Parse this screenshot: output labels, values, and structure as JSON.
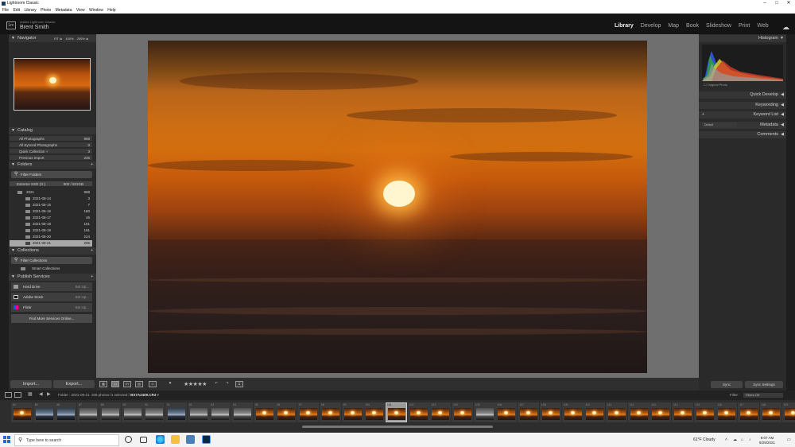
{
  "window": {
    "title": "Lightroom Classic",
    "minimize": "–",
    "maximize": "□",
    "close": "✕"
  },
  "menu": [
    "File",
    "Edit",
    "Library",
    "Photo",
    "Metadata",
    "View",
    "Window",
    "Help"
  ],
  "identity": {
    "app": "Adobe Lightroom Classic",
    "user": "Brent Smith",
    "logo": "Lrc"
  },
  "modules": [
    "Library",
    "Develop",
    "Map",
    "Book",
    "Slideshow",
    "Print",
    "Web"
  ],
  "active_module": "Library",
  "navigator": {
    "label": "Navigator",
    "zoom": [
      "FIT ≑",
      "100%",
      "200% ≑"
    ]
  },
  "catalog": {
    "label": "Catalog",
    "items": [
      {
        "name": "All Photographs",
        "count": "968"
      },
      {
        "name": "All Synced Photographs",
        "count": "0"
      },
      {
        "name": "Quick Collection +",
        "count": "3"
      },
      {
        "name": "Previous Import",
        "count": "245"
      }
    ]
  },
  "folders": {
    "label": "Folders",
    "filter": "Filter Folders",
    "drive": {
      "name": "Extreme SSD (G:)",
      "space": "900 / 931GB"
    },
    "year": {
      "name": "2021",
      "count": "968"
    },
    "items": [
      {
        "name": "2021-08-14",
        "count": "3"
      },
      {
        "name": "2021-08-15",
        "count": "7"
      },
      {
        "name": "2021-08-16",
        "count": "180"
      },
      {
        "name": "2021-08-17",
        "count": "46"
      },
      {
        "name": "2021-08-18",
        "count": "161"
      },
      {
        "name": "2021-08-19",
        "count": "191"
      },
      {
        "name": "2021-08-20",
        "count": "224"
      },
      {
        "name": "2021-08-21",
        "count": "206"
      }
    ]
  },
  "collections": {
    "label": "Collections",
    "filter": "Filter Collections",
    "items": [
      "Smart Collections"
    ]
  },
  "publish": {
    "label": "Publish Services",
    "items": [
      {
        "name": "Hard Drive",
        "setup": "Set Up..."
      },
      {
        "name": "Adobe Stock",
        "setup": "Set Up..."
      },
      {
        "name": "Flickr",
        "setup": "Set Up..."
      }
    ],
    "more": "Find More Services Online..."
  },
  "buttons": {
    "import": "Import...",
    "export": "Export...",
    "sync": "Sync",
    "sync_settings": "Sync Settings"
  },
  "right": {
    "histogram": "Histogram",
    "exif": [
      "ISO 100",
      "84 mm",
      "f / 11.0",
      "1/2000 sec"
    ],
    "original": "Original Photo",
    "panels": [
      "Quick Develop",
      "Keywording",
      "Keyword List",
      "Metadata",
      "Comments"
    ],
    "saved_preset": "Custom",
    "metadata_preset": "Default"
  },
  "toolbar": {
    "stars": "★★★★★"
  },
  "filmstrip": {
    "source": "Folder : 2021-08-21",
    "count": "206 photos /1 selected /",
    "file": "BS7A2409.CR3",
    "filter_label": "Filter :",
    "filter_value": "Filters Off",
    "numbers": [
      "84",
      "85",
      "86",
      "87",
      "88",
      "89",
      "90",
      "91",
      "92",
      "93",
      "94",
      "95",
      "96",
      "97",
      "98",
      "99",
      "100",
      "101",
      "102",
      "103",
      "104",
      "105",
      "106",
      "107",
      "108",
      "109",
      "110",
      "111",
      "112",
      "113",
      "114",
      "115",
      "116",
      "117",
      "118",
      "119"
    ],
    "kinds": [
      "ot",
      "bl",
      "bl",
      "gr",
      "gr",
      "gr",
      "gr",
      "bl",
      "gr",
      "gr",
      "gr",
      "ot",
      "ot",
      "ot",
      "ot",
      "ot",
      "ot",
      "ot",
      "ot",
      "ot",
      "ot",
      "gr",
      "ot",
      "ot",
      "ot",
      "ot",
      "ot",
      "ot",
      "ot",
      "ot",
      "ot",
      "ot",
      "ot",
      "ot",
      "ot",
      "ot"
    ],
    "selected_index": 17
  },
  "taskbar": {
    "search": "Type here to search",
    "weather": "61°F  Cloudy",
    "time": "9:07 AM",
    "date": "8/29/2021"
  },
  "colors": {
    "accent": "#f0f0f0",
    "panel": "#2a2a2a",
    "center": "#6f6f6f"
  }
}
